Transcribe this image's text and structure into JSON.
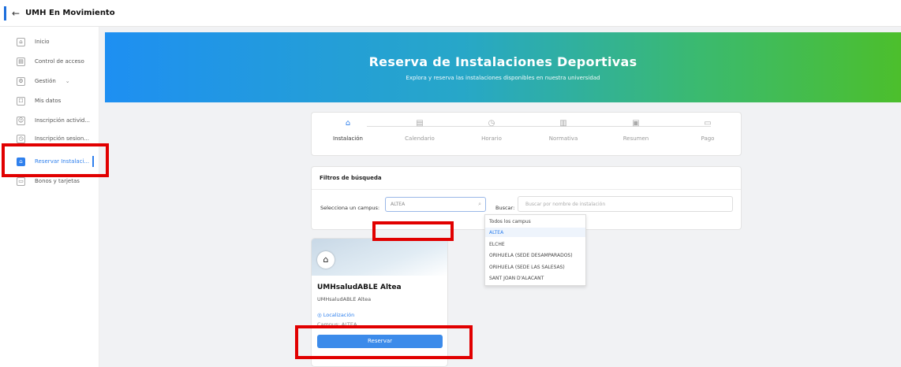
{
  "app": {
    "back_icon": "arrow-left-icon",
    "title": "UMH En Movimiento"
  },
  "sidebar": {
    "items": [
      {
        "label": "Inicio",
        "icon": "home-icon"
      },
      {
        "label": "Control de acceso",
        "icon": "calendar-icon"
      },
      {
        "label": "Gestión",
        "icon": "settings-icon",
        "chevron": "⌄"
      },
      {
        "label": "Mis datos",
        "icon": "user-card-icon"
      },
      {
        "label": "Inscripción activid...",
        "icon": "person-icon"
      },
      {
        "label": "Inscripción sesion...",
        "icon": "clock-icon"
      },
      {
        "label": "Reservar Instalaci...",
        "icon": "home-icon"
      },
      {
        "label": "Bonos y tarjetas",
        "icon": "card-icon"
      }
    ]
  },
  "banner": {
    "title": "Reserva de Instalaciones Deportivas",
    "subtitle": "Explora y reserva las instalaciones disponibles en nuestra universidad"
  },
  "steps": [
    {
      "label": "Instalación",
      "icon": "home-icon"
    },
    {
      "label": "Calendario",
      "icon": "calendar-icon"
    },
    {
      "label": "Horario",
      "icon": "clock-icon"
    },
    {
      "label": "Normativa",
      "icon": "document-icon"
    },
    {
      "label": "Resumen",
      "icon": "receipt-icon"
    },
    {
      "label": "Pago",
      "icon": "card-icon"
    }
  ],
  "filters": {
    "title": "Filtros de búsqueda",
    "campus_label": "Selecciona un campus:",
    "campus_value": "ALTEA",
    "search_label": "Buscar:",
    "search_placeholder": "Buscar por nombre de instalación"
  },
  "dropdown": {
    "options": [
      "Todos los campus",
      "ALTEA",
      "ELCHE",
      "ORIHUELA (SEDE DESAMPARADOS)",
      "ORIHUELA (SEDE LAS SALESAS)",
      "SANT JOAN D'ALACANT"
    ],
    "selected": "ALTEA"
  },
  "card": {
    "title": "UMHsaludABLE Altea",
    "subtitle": "UMHsaludABLE Altea",
    "location_label": "Localización",
    "campus_label": "Campus: ALTEA",
    "reserve_label": "Reservar"
  },
  "colors": {
    "accent": "#2f80ed",
    "highlight_box": "#e10000"
  }
}
